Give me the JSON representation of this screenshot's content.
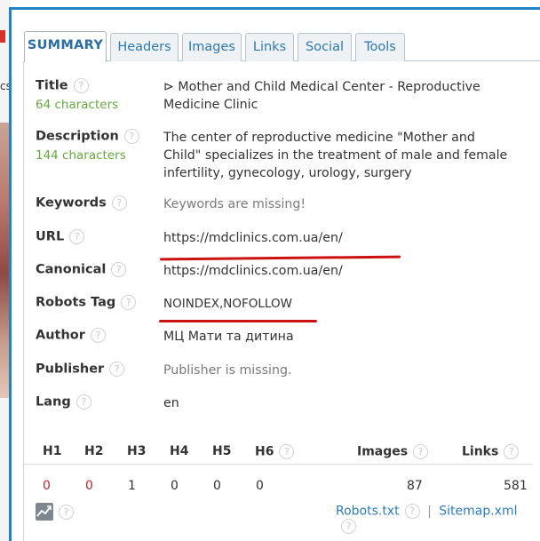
{
  "background_page": {
    "letters": "cs"
  },
  "tabs": [
    {
      "label": "SUMMARY",
      "active": true
    },
    {
      "label": "Headers",
      "active": false
    },
    {
      "label": "Images",
      "active": false
    },
    {
      "label": "Links",
      "active": false
    },
    {
      "label": "Social",
      "active": false
    },
    {
      "label": "Tools",
      "active": false
    }
  ],
  "help_glyph": "?",
  "fields": {
    "title": {
      "label": "Title",
      "sub": "64 characters",
      "value": "⊳ Mother and Child Medical Center - Reproductive Medicine Clinic"
    },
    "description": {
      "label": "Description",
      "sub": "144 characters",
      "value": "The center of reproductive medicine \"Mother and Child\" specializes in the treatment of male and female infertility, gynecology, urology, surgery"
    },
    "keywords": {
      "label": "Keywords",
      "value": "Keywords are missing!"
    },
    "url": {
      "label": "URL",
      "value": "https://mdclinics.com.ua/en/"
    },
    "canonical": {
      "label": "Canonical",
      "value": "https://mdclinics.com.ua/en/"
    },
    "robots": {
      "label": "Robots Tag",
      "value": "NOINDEX,NOFOLLOW"
    },
    "author": {
      "label": "Author",
      "value": "МЦ Мати та дитина"
    },
    "publisher": {
      "label": "Publisher",
      "value": "Publisher is missing."
    },
    "lang": {
      "label": "Lang",
      "value": "en"
    }
  },
  "headings": {
    "columns": [
      "H1",
      "H2",
      "H3",
      "H4",
      "H5",
      "H6"
    ],
    "values": [
      "0",
      "0",
      "1",
      "0",
      "0",
      "0"
    ],
    "images_label": "Images",
    "images_value": "87",
    "links_label": "Links",
    "links_value": "581"
  },
  "footer": {
    "robots_link": "Robots.txt",
    "separator": "|",
    "sitemap_link": "Sitemap.xml"
  },
  "colors": {
    "accent": "#1f83c6",
    "link": "#2b7bbf",
    "char_count": "#64a93c",
    "annotation_red": "#cc1111"
  }
}
